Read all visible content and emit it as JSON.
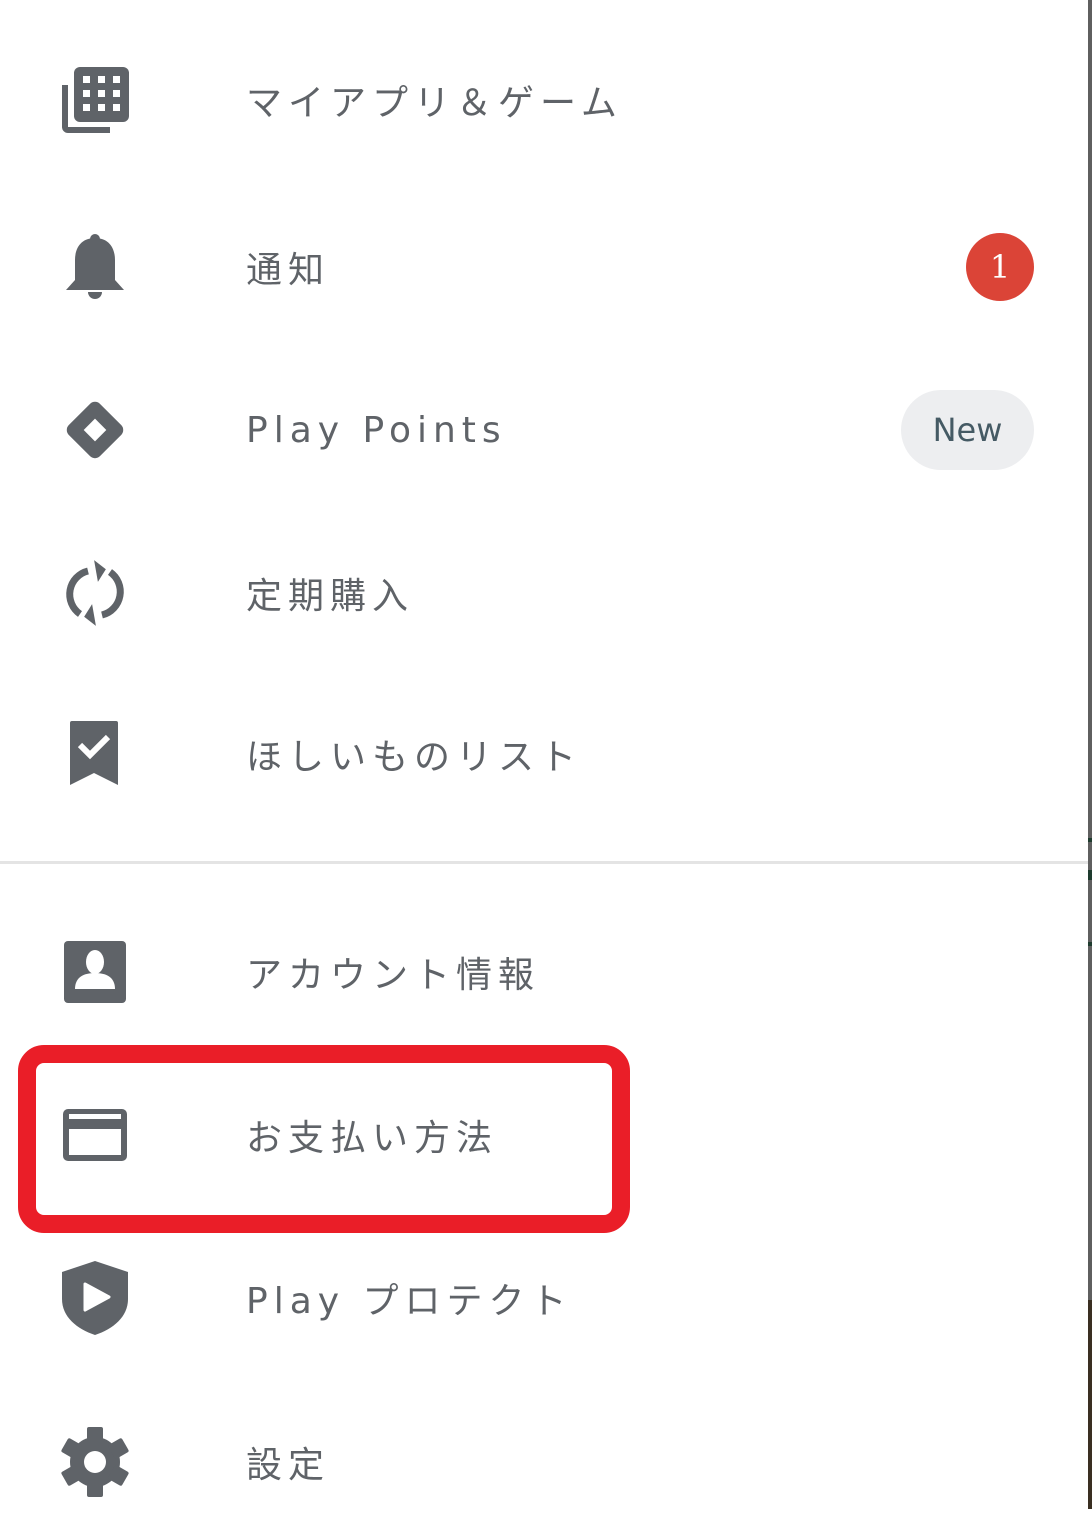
{
  "nav_drawer": {
    "primary_items": [
      {
        "id": "my-apps-games",
        "icon": "apps-library-icon",
        "label": "マイアプリ＆ゲーム"
      },
      {
        "id": "notifications",
        "icon": "bell-icon",
        "label": "通知",
        "badge_count": "1"
      },
      {
        "id": "play-points",
        "icon": "play-points-diamond-icon",
        "label": "Play Points",
        "badge_text": "New"
      },
      {
        "id": "subscriptions",
        "icon": "sync-icon",
        "label": "定期購入"
      },
      {
        "id": "wishlist",
        "icon": "bookmark-check-icon",
        "label": "ほしいものリスト"
      }
    ],
    "secondary_items": [
      {
        "id": "account",
        "icon": "account-box-icon",
        "label": "アカウント情報"
      },
      {
        "id": "payment-methods",
        "icon": "credit-card-icon",
        "label": "お支払い方法",
        "highlighted": true
      },
      {
        "id": "play-protect",
        "icon": "shield-play-icon",
        "label": "Play プロテクト"
      },
      {
        "id": "settings",
        "icon": "gear-icon",
        "label": "設定"
      }
    ]
  },
  "colors": {
    "icon_text": "#5f6368",
    "notification_badge": "#db4437",
    "new_badge_bg": "#edeef0",
    "highlight_border": "#ea1e28"
  }
}
